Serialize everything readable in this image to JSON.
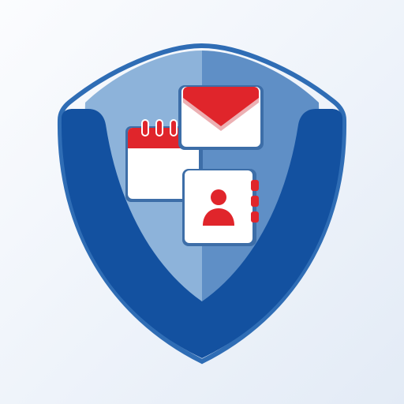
{
  "app_icon": {
    "background": "#eef3fa",
    "shield": {
      "outer_color": "#1351a0",
      "inner_left_color": "#8db3da",
      "inner_right_color": "#5f8fc6",
      "rim_color": "#2f6db5"
    },
    "cards": {
      "card_color": "#ffffff",
      "card_shadow_color": "#3d6ea8",
      "accent_color": "#e0252b",
      "accent_dark_color": "#c81e24"
    },
    "icons": [
      "shield-icon",
      "mail-icon",
      "calendar-icon",
      "contacts-icon"
    ]
  }
}
